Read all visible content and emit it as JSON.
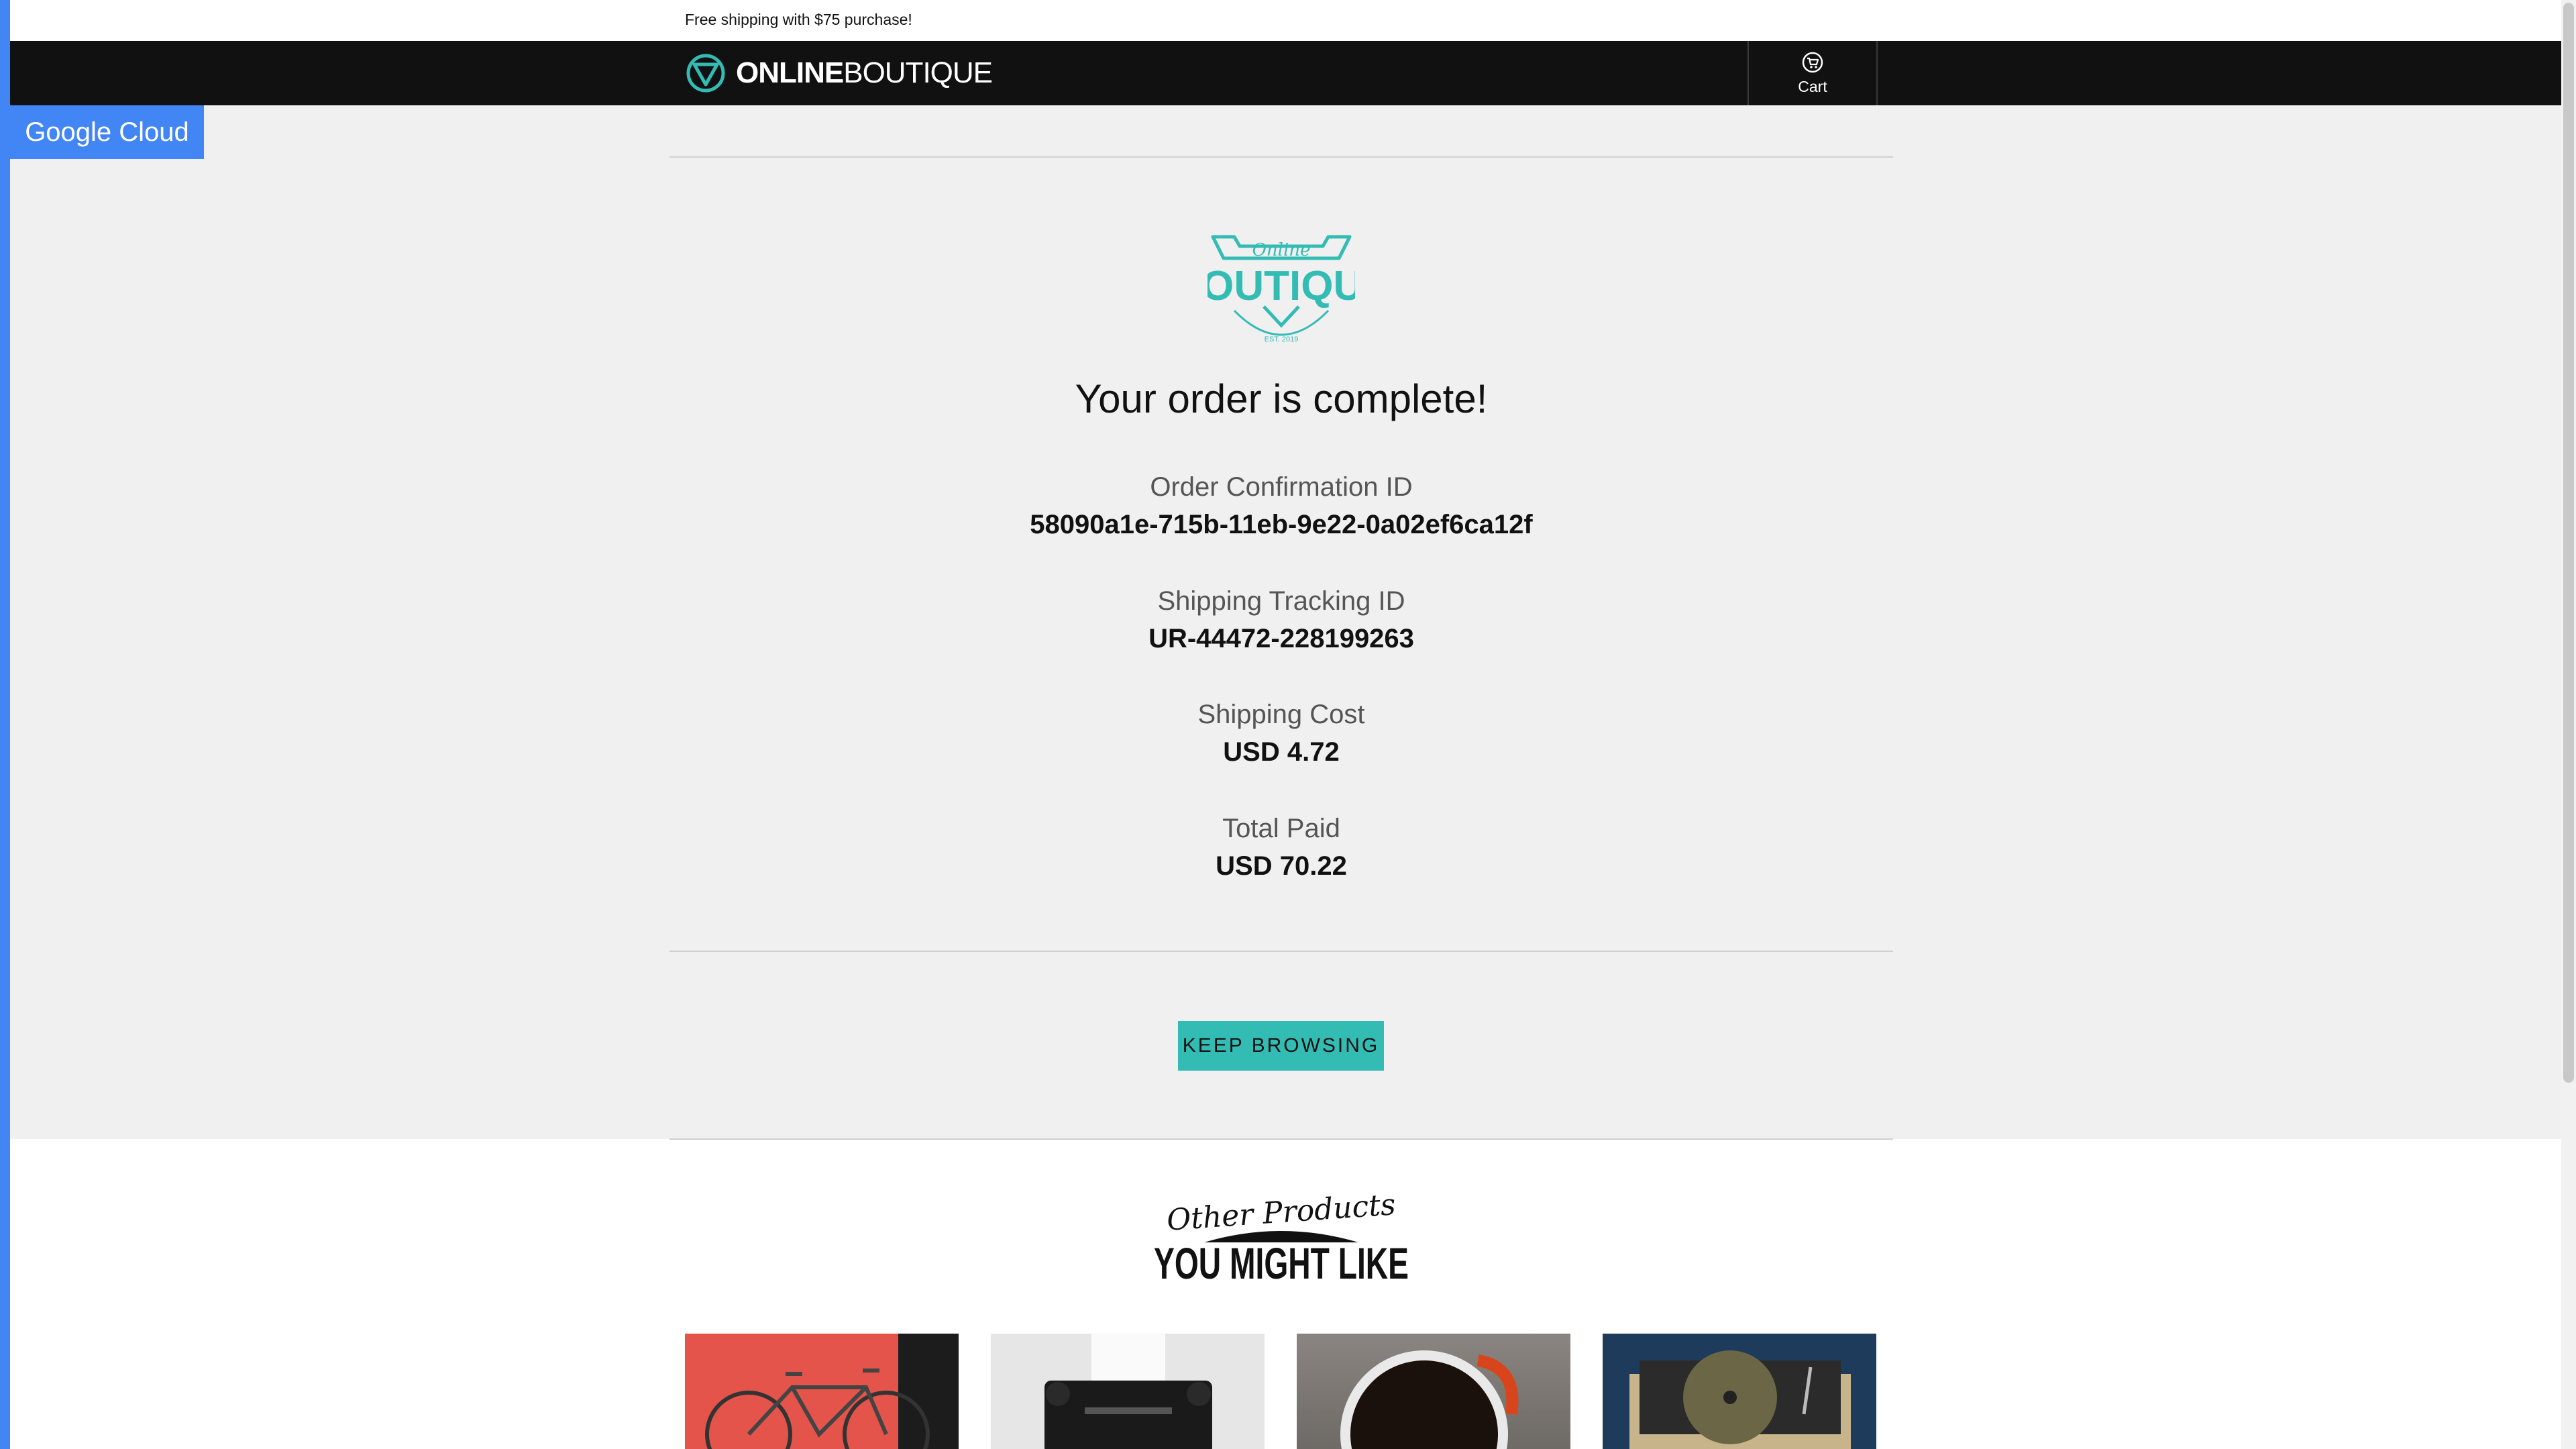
{
  "banner": {
    "text": "Free shipping with $75 purchase!"
  },
  "header": {
    "logo_bold": "ONLINE",
    "logo_light": "BOUTIQUE",
    "cart_label": "Cart"
  },
  "badge": {
    "text": "Google Cloud"
  },
  "order": {
    "heading": "Your order is complete!",
    "confirmation_label": "Order Confirmation ID",
    "confirmation_value": "58090a1e-715b-11eb-9e22-0a02ef6ca12f",
    "tracking_label": "Shipping Tracking ID",
    "tracking_value": "UR-44472-228199263",
    "shipping_label": "Shipping Cost",
    "shipping_value": "USD 4.72",
    "total_label": "Total Paid",
    "total_value": "USD 70.22"
  },
  "keep_browsing": {
    "label": "KEEP BROWSING"
  },
  "recommendations": {
    "title_script": "Other Products",
    "title_main": "YOU MIGHT LIKE"
  },
  "brand": {
    "script": "Online",
    "main": "BOUTIQUE",
    "est": "EST. 2019"
  },
  "colors": {
    "accent": "#33bcb4",
    "google_blue": "#4285f4",
    "nav_bg": "#111111"
  }
}
